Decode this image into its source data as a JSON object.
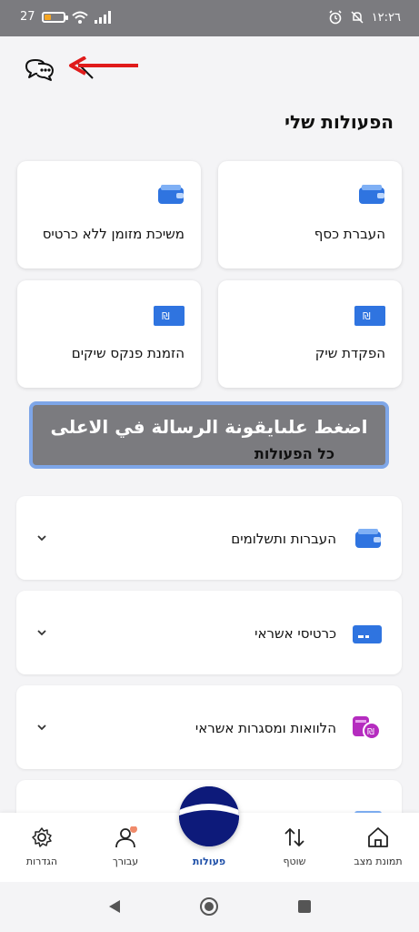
{
  "status_bar": {
    "battery": "27",
    "time": "١٢:٢٦"
  },
  "header": {
    "section_title": "הפעולות שלי"
  },
  "quick_actions": [
    {
      "label": "העברת כסף",
      "icon": "wallet-icon"
    },
    {
      "label": "משיכת מזומן ללא כרטיס",
      "icon": "wallet-icon"
    },
    {
      "label": "הפקדת שיק",
      "icon": "shekel-check-icon"
    },
    {
      "label": "הזמנת פנקס שיקים",
      "icon": "shekel-check-icon"
    }
  ],
  "instruction_overlay": {
    "text": "اضغط علىايقونة الرسالة في الاعلى",
    "underlying_text": "כל הפעולות"
  },
  "categories": [
    {
      "label": "העברות ותשלומים",
      "icon": "wallet-icon"
    },
    {
      "label": "כרטיסי אשראי",
      "icon": "credit-card-icon"
    },
    {
      "label": "הלוואות ומסגרות אשראי",
      "icon": "loan-coins-icon"
    }
  ],
  "bottom_nav": [
    {
      "label": "תמונת מצב",
      "icon": "home-icon"
    },
    {
      "label": "שוטף",
      "icon": "transfer-arrows-icon"
    },
    {
      "label": "פעולות",
      "icon": "actions-fab-icon",
      "active": true
    },
    {
      "label": "עבורך",
      "icon": "person-icon"
    },
    {
      "label": "הגדרות",
      "icon": "gear-icon"
    }
  ],
  "colors": {
    "accent": "#1e4fa8",
    "icon_blue": "#2f74e0",
    "overlay": "#7b7b7f",
    "overlay_border": "#7ea6e8",
    "arrow_red": "#e01b1b",
    "fab": "#0d1a7a",
    "loan_purple": "#b52cbf"
  }
}
